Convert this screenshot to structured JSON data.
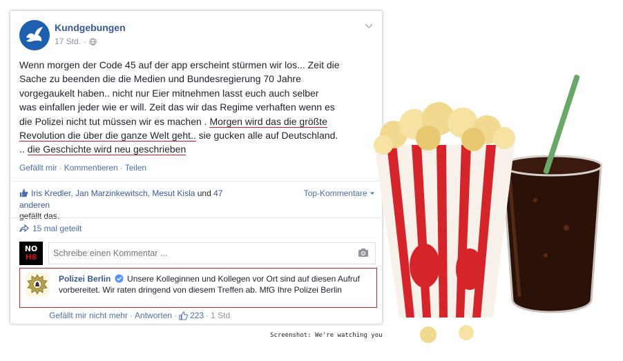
{
  "post": {
    "page_name": "Kundgebungen",
    "time": "17 Std.",
    "separator": "·",
    "text_lines": {
      "l1": "Wenn morgen der Code 45 auf der app erscheint stürmen wir los... Zeit die",
      "l2": "Sache zu beenden die die Medien und Bundesregierung 70 Jahre",
      "l3": "vorgegaukelt haben.. nicht nur Eier mitnehmen lasst euch auch selber",
      "l4": "was einfallen jeder wie er will. Zeit das wir das Regime verhaften wenn es",
      "l5a": "die Polizei nicht tut müssen wir es machen . ",
      "l5b": "Morgen wird das die größte",
      "l6a": "Revolution die über die ganze Welt geht..",
      "l6b": " sie gucken alle auf Deutschland.",
      "l7a": ".. ",
      "l7b": "die Geschichte wird neu geschrieben"
    },
    "actions": {
      "like": "Gefällt mir",
      "comment": "Kommentieren",
      "share": "Teilen",
      "sep": "·"
    }
  },
  "likes": {
    "names": "Iris Kredler, Jan Marzinkewitsch, Mesut Kisla",
    "und": " und ",
    "others": "47 anderen",
    "suffix": "gefällt das.",
    "sort_label": "Top-Kommentare"
  },
  "shares": {
    "label": "15 mal geteilt"
  },
  "comment_box": {
    "placeholder": "Schreibe einen Kommentar ...",
    "avatar_line1": "NO",
    "avatar_line2": "H8"
  },
  "reply": {
    "author": "Polizei Berlin",
    "text": "Unsere Kolleginnen und Kollegen vor Ort sind auf diesen Aufruf vorbereitet. Wir raten dringend von diesem Treffen ab. MfG Ihre Polizei Berlin",
    "unlike": "Gefällt mir nicht mehr",
    "reply_label": "Antworten",
    "like_count": "223",
    "time": "1 Std",
    "sep": "·"
  },
  "caption": "Screenshot: We're watching you",
  "colors": {
    "link": "#365899",
    "highlight_underline": "#d0162a",
    "police_border": "#c9262c",
    "page_avatar": "#1f5fb0"
  }
}
